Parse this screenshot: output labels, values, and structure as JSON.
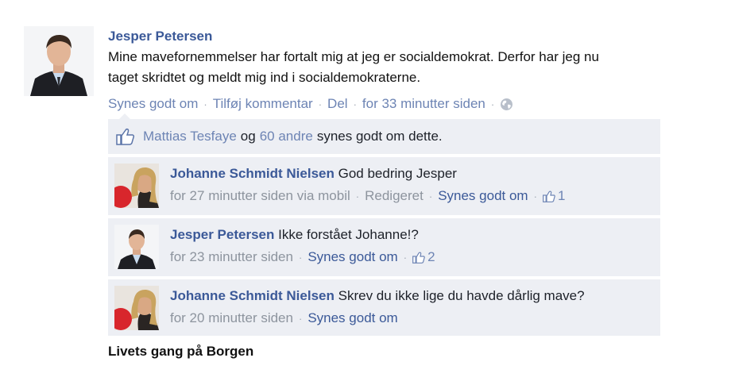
{
  "post": {
    "author": "Jesper Petersen",
    "text_line1": "Mine mavefornemmelser har fortalt mig at jeg er socialdemokrat. Derfor har jeg nu",
    "text_line2": "taget skridtet og meldt mig ind i socialdemokraterne.",
    "actions": {
      "like": "Synes godt om",
      "comment": "Tilføj kommentar",
      "share": "Del",
      "time": "for 33 minutter siden"
    },
    "icon": "globe-icon"
  },
  "likes": {
    "name": "Mattias Tesfaye",
    "and": "og",
    "others": "60 andre",
    "suffix": "synes godt om dette.",
    "icon": "thumbs-up-icon"
  },
  "comments": [
    {
      "author": "Johanne Schmidt Nielsen",
      "text": "God bedring Jesper",
      "time": "for 27 minutter siden via mobil",
      "edited": "Redigeret",
      "like": "Synes godt om",
      "like_count": "1"
    },
    {
      "author": "Jesper Petersen",
      "text": "Ikke forstået Johanne!?",
      "time": "for 23 minutter siden",
      "like": "Synes godt om",
      "like_count": "2"
    },
    {
      "author": "Johanne Schmidt Nielsen",
      "text": "Skrev du ikke lige du havde dårlig mave?",
      "time": "for 20 minutter siden",
      "like": "Synes godt om"
    }
  ],
  "caption": "Livets gang på Borgen",
  "colors": {
    "link": "#3b5998",
    "muted_link": "#6d84b4",
    "meta": "#8d949e",
    "panel": "#edeff4"
  }
}
